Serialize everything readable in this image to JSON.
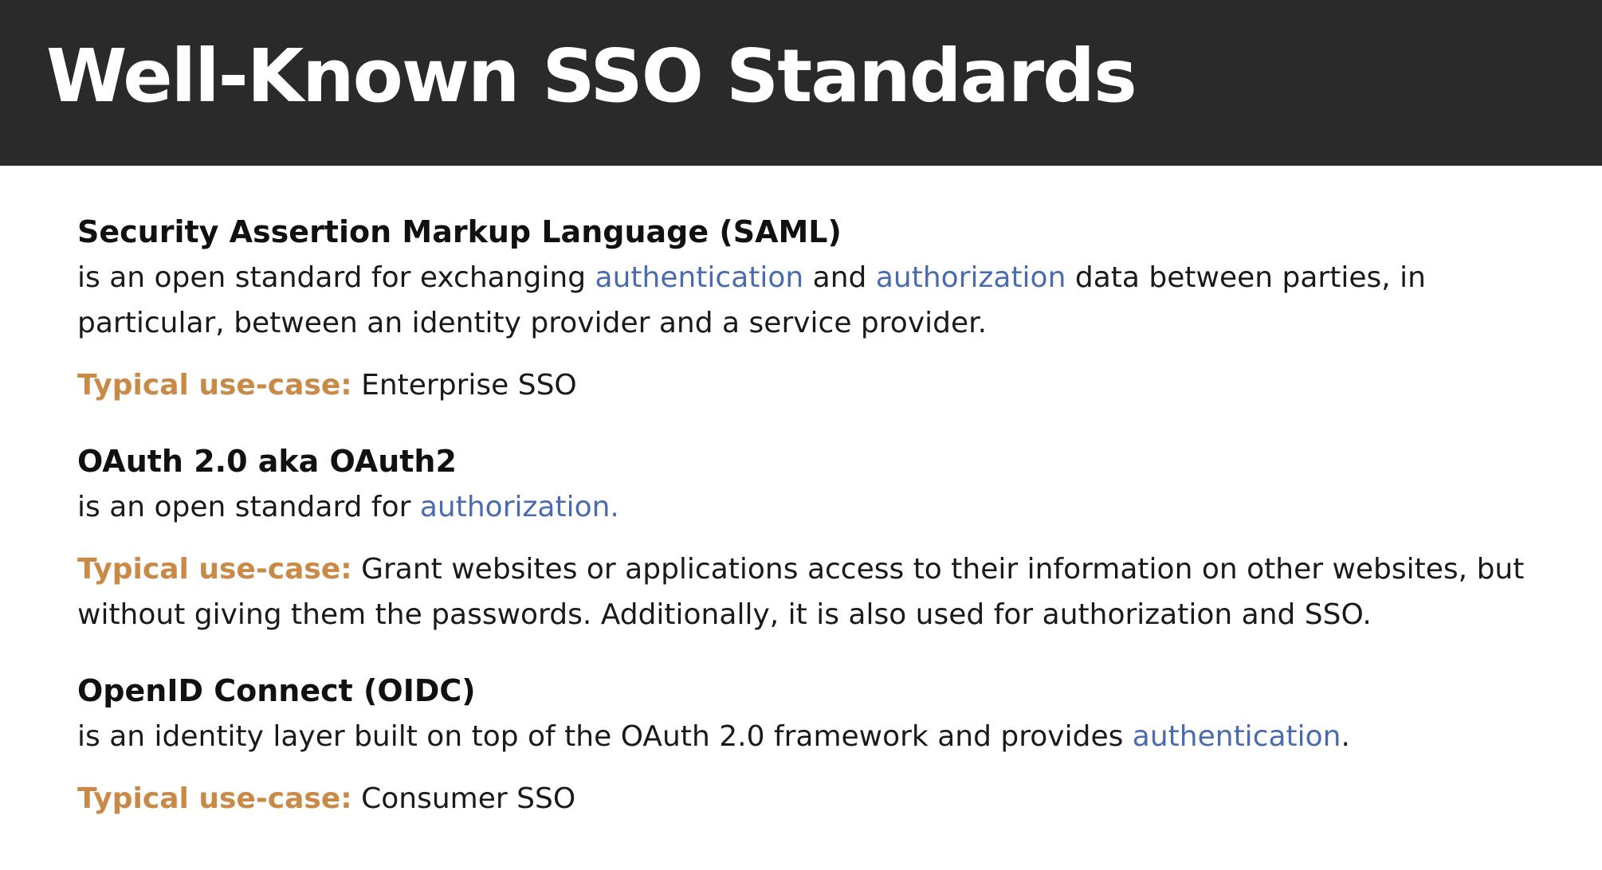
{
  "page": {
    "title": "Well-Known SSO Standards"
  },
  "colors": {
    "title_bar_background": "#2a2a2a",
    "link_blue": "#4a6bb0",
    "use_case_label": "#c98a47"
  },
  "sections": [
    {
      "heading": "Security Assertion Markup Language (SAML)",
      "desc_parts": [
        "is an open standard for exchanging ",
        "authentication",
        " and ",
        "authorization",
        " data between parties, in particular, between an identity provider and a service provider."
      ],
      "use_case_label": "Typical use-case:",
      "use_case_text": " Enterprise SSO"
    },
    {
      "heading": "OAuth 2.0 aka OAuth2",
      "desc_parts": [
        "is an open standard for ",
        "authorization."
      ],
      "use_case_label": "Typical use-case:",
      "use_case_text": " Grant websites or applications access to their information on other websites, but without giving them the passwords. Additionally, it is also used for authorization and SSO."
    },
    {
      "heading": "OpenID Connect (OIDC)",
      "desc_parts": [
        "is an identity layer built on top of the OAuth 2.0 framework and provides ",
        "authentication",
        "."
      ],
      "use_case_label": "Typical use-case:",
      "use_case_text": " Consumer SSO"
    }
  ]
}
